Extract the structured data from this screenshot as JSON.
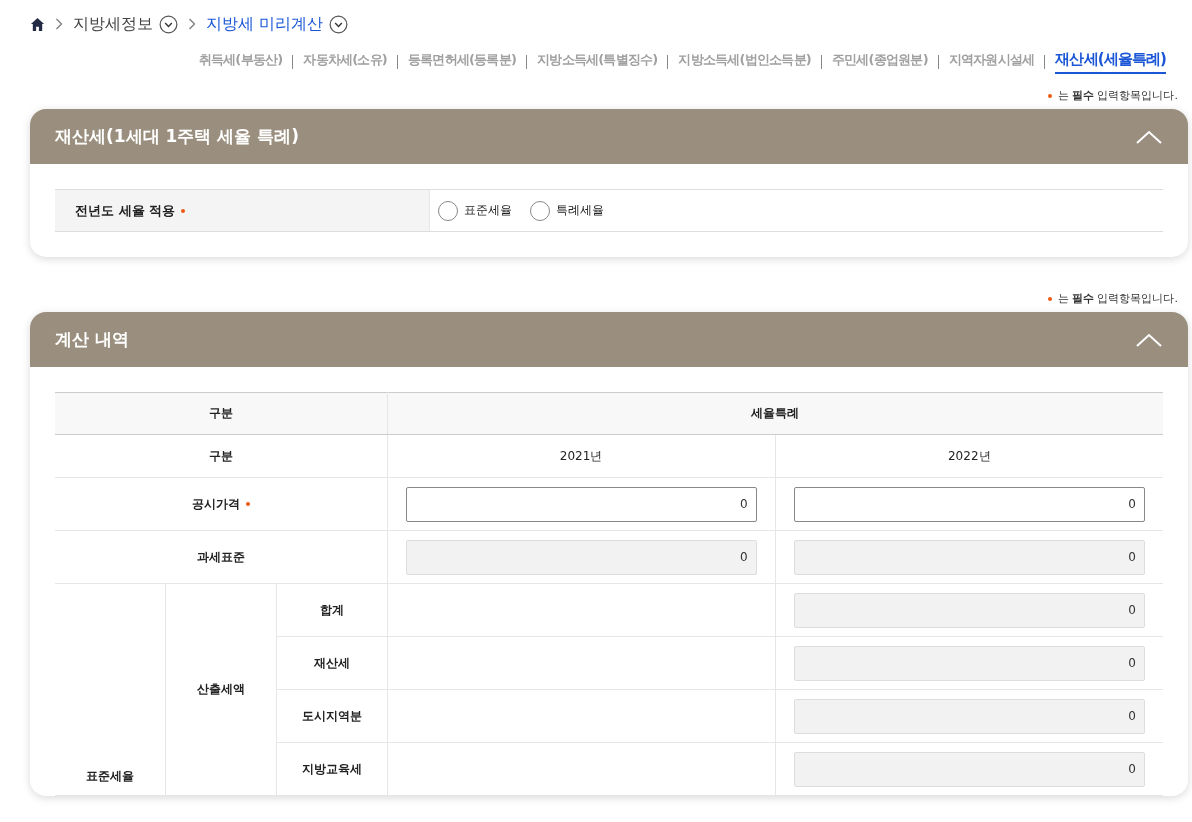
{
  "breadcrumb": [
    {
      "label": "지방세정보",
      "current": false
    },
    {
      "label": "지방세 미리계산",
      "current": true
    }
  ],
  "tabs": [
    {
      "label": "취득세(부동산)",
      "selected": false
    },
    {
      "label": "자동차세(소유)",
      "selected": false
    },
    {
      "label": "등록면허세(등록분)",
      "selected": false
    },
    {
      "label": "지방소득세(특별징수)",
      "selected": false
    },
    {
      "label": "지방소득세(법인소득분)",
      "selected": false
    },
    {
      "label": "주민세(종업원분)",
      "selected": false
    },
    {
      "label": "지역자원시설세",
      "selected": false
    },
    {
      "label": "재산세(세율특례)",
      "selected": true
    }
  ],
  "sections": [
    {
      "notice": "는 **필수** 입력항목입니다.",
      "title": "재산세(1세대 1주택 세율 특례)",
      "expanded": true,
      "kind": "form",
      "field": {
        "label": "전년도 세율 적용",
        "required": true,
        "options": [
          {
            "label": "표준세율",
            "selected": false
          },
          {
            "label": "특례세율",
            "selected": false
          }
        ]
      }
    },
    {
      "notice": "는 **필수** 입력항목입니다.",
      "title": "계산 내역",
      "expanded": true,
      "kind": "table",
      "table": {
        "header": [
          "구분",
          "세율특례"
        ],
        "year_row": {
          "label": "구분",
          "years": [
            "2021년",
            "2022년"
          ]
        },
        "rows": [
          {
            "label": "공시가격",
            "required": true,
            "fields": [
              {
                "value": "0",
                "disabled": false
              },
              {
                "value": "0",
                "disabled": false
              }
            ]
          },
          {
            "label": "과세표준",
            "required": false,
            "fields": [
              {
                "value": "0",
                "disabled": true
              },
              {
                "value": "0",
                "disabled": true
              }
            ]
          }
        ],
        "group": {
          "label": "표준세율",
          "sublabel": "산출세액",
          "items": [
            {
              "label": "합계",
              "field_2022": {
                "value": "0",
                "disabled": true
              }
            },
            {
              "label": "재산세",
              "field_2022": {
                "value": "0",
                "disabled": true
              }
            },
            {
              "label": "도시지역분",
              "field_2022": {
                "value": "0",
                "disabled": true
              }
            },
            {
              "label": "지방교육세",
              "field_2022": {
                "value": "0",
                "disabled": true
              }
            }
          ]
        }
      }
    }
  ]
}
